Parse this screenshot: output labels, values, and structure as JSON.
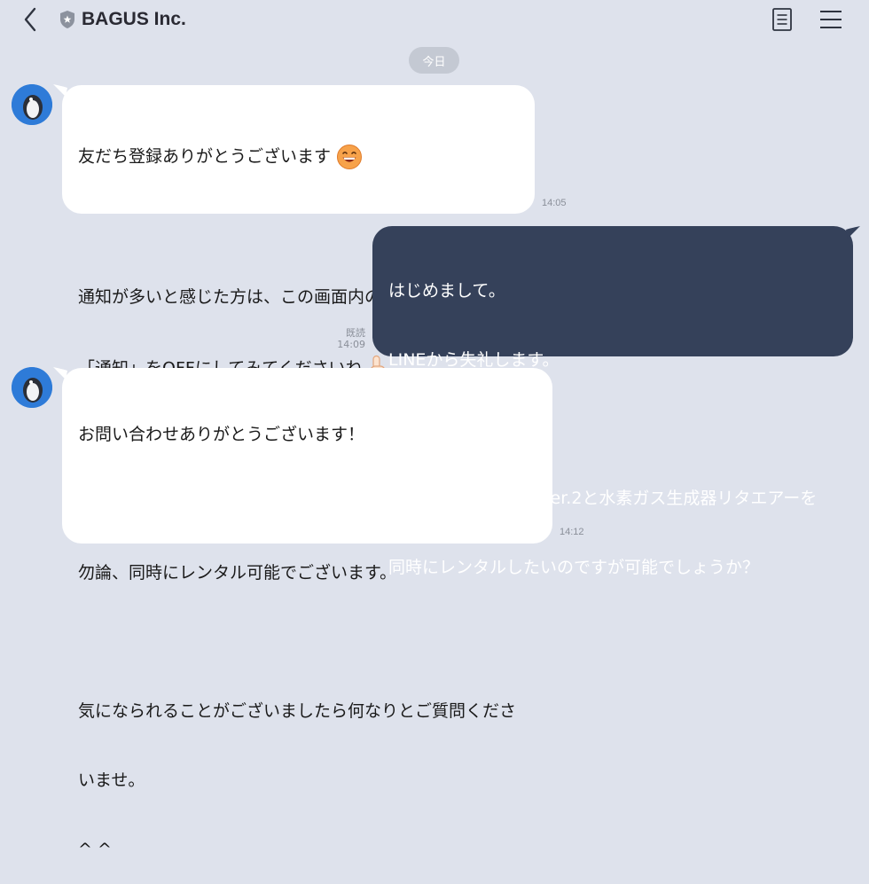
{
  "header": {
    "title": "BAGUS Inc.",
    "icons": [
      "back-chevron-icon",
      "shield-badge-icon",
      "notes-icon",
      "menu-icon"
    ]
  },
  "date_chip": "今日",
  "colors": {
    "background": "#DEE2EC",
    "incoming_bubble": "#FFFFFF",
    "outgoing_bubble": "#35415A",
    "timestamp": "#8A8F99",
    "avatar": "#2E7BD8"
  },
  "messages": [
    {
      "direction": "incoming",
      "lines": [
        "友だち登録ありがとうございます",
        "",
        "通知が多いと感じた方は、この画面内のトーク設定より",
        "「通知」をOFFにしてみてくださいね"
      ],
      "emojis": [
        "grinning-face-icon",
        "thumbs-up-icon"
      ],
      "time": "14:05"
    },
    {
      "direction": "outgoing",
      "lines": [
        "はじめまして。",
        "LINEから失礼します。",
        "",
        "水素風呂リタライフVer.2と水素ガス生成器リタエアーを",
        "同時にレンタルしたいのですが可能でしょうか？"
      ],
      "read_label": "既読",
      "time": "14:09"
    },
    {
      "direction": "incoming",
      "lines": [
        "お問い合わせありがとうございます！",
        "",
        "勿論、同時にレンタル可能でございます。",
        "",
        "気になられることがございましたら何なりとご質問くださ",
        "いませ。",
        "^ ^"
      ],
      "time": "14:12"
    }
  ]
}
